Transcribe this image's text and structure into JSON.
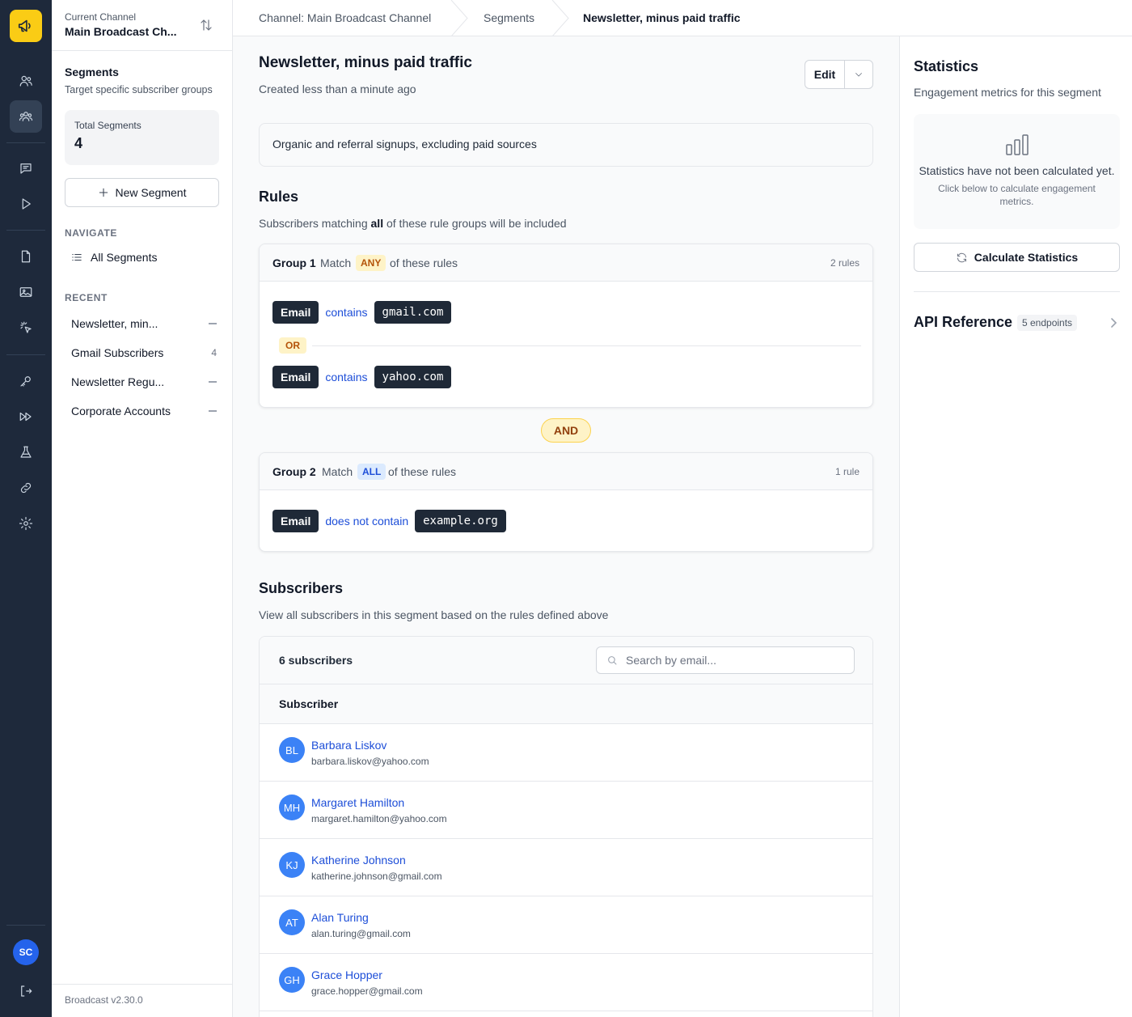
{
  "colors": {
    "rail_bg": "#1e293b",
    "logo_bg": "#facc15",
    "link": "#1d4ed8",
    "avatar": "#3b82f6"
  },
  "sidebar": {
    "channel_label": "Current Channel",
    "channel_name": "Main Broadcast Ch...",
    "title": "Segments",
    "subtitle": "Target specific subscriber groups",
    "total_label": "Total Segments",
    "total_value": "4",
    "new_segment_label": "New Segment",
    "navigate_heading": "NAVIGATE",
    "all_segments_label": "All Segments",
    "recent_heading": "RECENT",
    "recent": [
      {
        "name": "Newsletter, min...",
        "count": ""
      },
      {
        "name": "Gmail Subscribers",
        "count": "4"
      },
      {
        "name": "Newsletter Regu...",
        "count": ""
      },
      {
        "name": "Corporate Accounts",
        "count": ""
      }
    ],
    "version": "Broadcast v2.30.0",
    "user_initials": "SC"
  },
  "breadcrumb": {
    "items": [
      "Channel: Main Broadcast Channel",
      "Segments",
      "Newsletter, minus paid traffic"
    ]
  },
  "page": {
    "title": "Newsletter, minus paid traffic",
    "created": "Created less than a minute ago",
    "edit_label": "Edit",
    "description": "Organic and referral signups, excluding paid sources"
  },
  "rules": {
    "heading": "Rules",
    "sub_pre": "Subscribers matching ",
    "sub_bold": "all",
    "sub_post": " of these rule groups will be included",
    "and_label": "AND",
    "groups": [
      {
        "name": "Group 1",
        "match": "Match",
        "mode": "ANY",
        "of": "of these rules",
        "count": "2 rules",
        "or_label": "OR",
        "rules": [
          {
            "field": "Email",
            "op": "contains",
            "value": "gmail.com"
          },
          {
            "field": "Email",
            "op": "contains",
            "value": "yahoo.com"
          }
        ]
      },
      {
        "name": "Group 2",
        "match": "Match",
        "mode": "ALL",
        "of": "of these rules",
        "count": "1 rule",
        "rules": [
          {
            "field": "Email",
            "op": "does not contain",
            "value": "example.org"
          }
        ]
      }
    ]
  },
  "subscribers": {
    "heading": "Subscribers",
    "sub": "View all subscribers in this segment based on the rules defined above",
    "count_label": "6 subscribers",
    "search_placeholder": "Search by email...",
    "column_header": "Subscriber",
    "rows": [
      {
        "initials": "BL",
        "name": "Barbara Liskov",
        "email": "barbara.liskov@yahoo.com"
      },
      {
        "initials": "MH",
        "name": "Margaret Hamilton",
        "email": "margaret.hamilton@yahoo.com"
      },
      {
        "initials": "KJ",
        "name": "Katherine Johnson",
        "email": "katherine.johnson@gmail.com"
      },
      {
        "initials": "AT",
        "name": "Alan Turing",
        "email": "alan.turing@gmail.com"
      },
      {
        "initials": "GH",
        "name": "Grace Hopper",
        "email": "grace.hopper@gmail.com"
      }
    ]
  },
  "stats": {
    "title": "Statistics",
    "sub": "Engagement metrics for this segment",
    "empty_main": "Statistics have not been calculated yet.",
    "empty_sub": "Click below to calculate engagement metrics.",
    "calc_label": "Calculate Statistics",
    "api_title": "API Reference",
    "api_badge": "5 endpoints"
  }
}
